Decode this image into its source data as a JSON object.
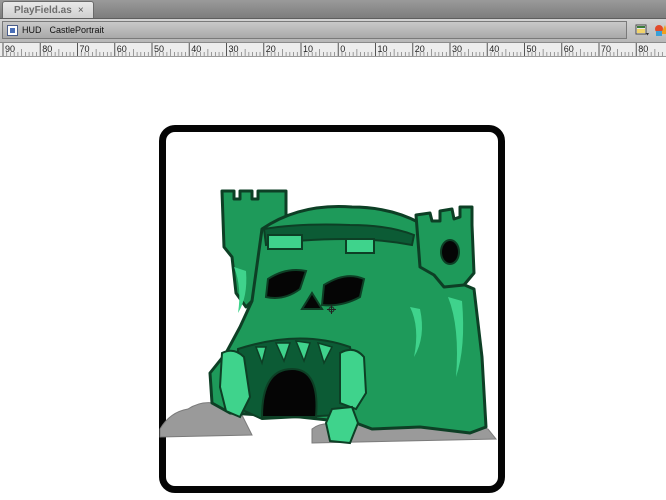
{
  "document_tabs": [
    {
      "label": "PlayField.as",
      "close_glyph": "×"
    }
  ],
  "edit_bar": {
    "breadcrumb": [
      {
        "label": "HUD"
      },
      {
        "label": "CastlePortrait"
      }
    ]
  },
  "toolbar_icons": [
    "edit-scene-icon",
    "edit-symbols-icon"
  ],
  "ruler": {
    "labels": [
      "90",
      "80",
      "70",
      "60",
      "50",
      "40",
      "30",
      "20",
      "10",
      "0",
      "10",
      "20",
      "30",
      "40",
      "50",
      "60",
      "70",
      "80"
    ]
  },
  "stage": {
    "symbol": "castle-grayskull-portrait",
    "colors": {
      "castle_green": "#1e9a5a",
      "castle_dark": "#0c5b35",
      "castle_light": "#3fd38c",
      "rock_gray": "#9a9a9a",
      "frame": "#050505"
    }
  }
}
